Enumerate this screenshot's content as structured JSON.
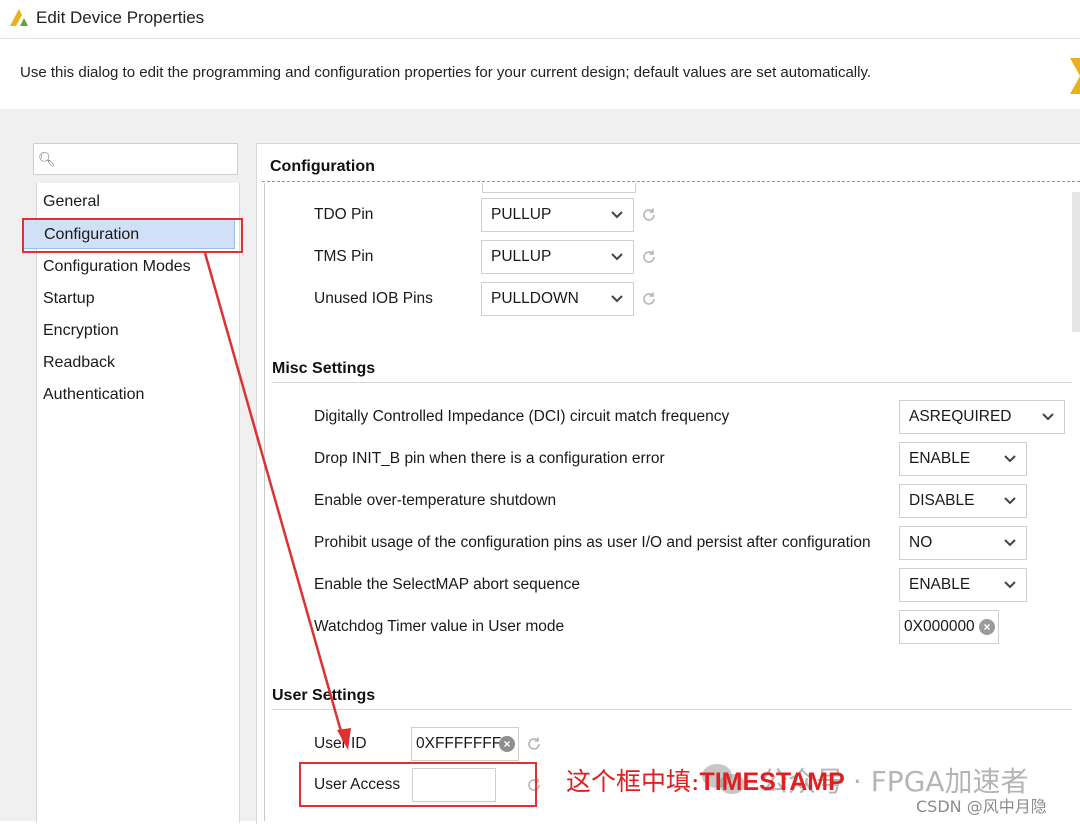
{
  "window": {
    "title": "Edit Device Properties",
    "logo_icon": "xilinx-logo-icon"
  },
  "description": "Use this dialog to edit the programming and configuration properties for your current design; default values are set automatically.",
  "search": {
    "value": "",
    "placeholder": ""
  },
  "nav": {
    "items": [
      {
        "label": "General"
      },
      {
        "label": "Configuration",
        "selected": true
      },
      {
        "label": "Configuration Modes"
      },
      {
        "label": "Startup"
      },
      {
        "label": "Encryption"
      },
      {
        "label": "Readback"
      },
      {
        "label": "Authentication"
      }
    ]
  },
  "panel": {
    "title": "Configuration",
    "pins": [
      {
        "label": "TDO Pin",
        "value": "PULLUP"
      },
      {
        "label": "TMS Pin",
        "value": "PULLUP"
      },
      {
        "label": "Unused IOB Pins",
        "value": "PULLDOWN"
      }
    ],
    "misc": {
      "title": "Misc Settings",
      "rows": [
        {
          "label": "Digitally Controlled Impedance (DCI) circuit match frequency",
          "value": "ASREQUIRED"
        },
        {
          "label": "Drop INIT_B pin when there is a configuration error",
          "value": "ENABLE"
        },
        {
          "label": "Enable over-temperature shutdown",
          "value": "DISABLE"
        },
        {
          "label": "Prohibit usage of the configuration pins as user I/O and persist after configuration",
          "value": "NO"
        },
        {
          "label": "Enable the SelectMAP abort sequence",
          "value": "ENABLE"
        },
        {
          "label": "Watchdog Timer value in User mode",
          "value": "0X000000"
        }
      ]
    },
    "user": {
      "title": "User Settings",
      "user_id": {
        "label": "User ID",
        "value": "0XFFFFFFFF"
      },
      "user_access": {
        "label": "User Access",
        "value": ""
      }
    }
  },
  "annotation": {
    "prefix": "这个框中填:",
    "keyword": "TIMESTAMP"
  },
  "watermark": {
    "line1": "公众号 · FPGA加速者",
    "line2": "CSDN @风中月隐"
  },
  "colors": {
    "highlight_red": "#e03131",
    "selection_blue": "#cfe0f7"
  }
}
